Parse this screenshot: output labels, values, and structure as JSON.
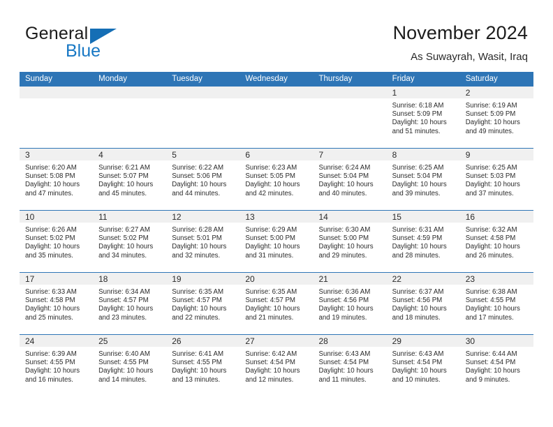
{
  "brand": {
    "word_one": "General",
    "word_two": "Blue",
    "accent_color": "#1878c4",
    "triangle_color": "#156eb5"
  },
  "header": {
    "title": "November 2024",
    "location": "As Suwayrah, Wasit, Iraq"
  },
  "theme": {
    "header_blue": "#2e75b6",
    "daynum_gray": "#f0f0f0",
    "text": "#2b2b2b"
  },
  "weekdays": [
    "Sunday",
    "Monday",
    "Tuesday",
    "Wednesday",
    "Thursday",
    "Friday",
    "Saturday"
  ],
  "labels": {
    "sunrise_prefix": "Sunrise:",
    "sunset_prefix": "Sunset:",
    "daylight_prefix": "Daylight:"
  },
  "weeks": [
    [
      {
        "day": "",
        "empty": true
      },
      {
        "day": "",
        "empty": true
      },
      {
        "day": "",
        "empty": true
      },
      {
        "day": "",
        "empty": true
      },
      {
        "day": "",
        "empty": true
      },
      {
        "day": "1",
        "sunrise": "Sunrise: 6:18 AM",
        "sunset": "Sunset: 5:09 PM",
        "daylight": "Daylight: 10 hours and 51 minutes."
      },
      {
        "day": "2",
        "sunrise": "Sunrise: 6:19 AM",
        "sunset": "Sunset: 5:09 PM",
        "daylight": "Daylight: 10 hours and 49 minutes."
      }
    ],
    [
      {
        "day": "3",
        "sunrise": "Sunrise: 6:20 AM",
        "sunset": "Sunset: 5:08 PM",
        "daylight": "Daylight: 10 hours and 47 minutes."
      },
      {
        "day": "4",
        "sunrise": "Sunrise: 6:21 AM",
        "sunset": "Sunset: 5:07 PM",
        "daylight": "Daylight: 10 hours and 45 minutes."
      },
      {
        "day": "5",
        "sunrise": "Sunrise: 6:22 AM",
        "sunset": "Sunset: 5:06 PM",
        "daylight": "Daylight: 10 hours and 44 minutes."
      },
      {
        "day": "6",
        "sunrise": "Sunrise: 6:23 AM",
        "sunset": "Sunset: 5:05 PM",
        "daylight": "Daylight: 10 hours and 42 minutes."
      },
      {
        "day": "7",
        "sunrise": "Sunrise: 6:24 AM",
        "sunset": "Sunset: 5:04 PM",
        "daylight": "Daylight: 10 hours and 40 minutes."
      },
      {
        "day": "8",
        "sunrise": "Sunrise: 6:25 AM",
        "sunset": "Sunset: 5:04 PM",
        "daylight": "Daylight: 10 hours and 39 minutes."
      },
      {
        "day": "9",
        "sunrise": "Sunrise: 6:25 AM",
        "sunset": "Sunset: 5:03 PM",
        "daylight": "Daylight: 10 hours and 37 minutes."
      }
    ],
    [
      {
        "day": "10",
        "sunrise": "Sunrise: 6:26 AM",
        "sunset": "Sunset: 5:02 PM",
        "daylight": "Daylight: 10 hours and 35 minutes."
      },
      {
        "day": "11",
        "sunrise": "Sunrise: 6:27 AM",
        "sunset": "Sunset: 5:02 PM",
        "daylight": "Daylight: 10 hours and 34 minutes."
      },
      {
        "day": "12",
        "sunrise": "Sunrise: 6:28 AM",
        "sunset": "Sunset: 5:01 PM",
        "daylight": "Daylight: 10 hours and 32 minutes."
      },
      {
        "day": "13",
        "sunrise": "Sunrise: 6:29 AM",
        "sunset": "Sunset: 5:00 PM",
        "daylight": "Daylight: 10 hours and 31 minutes."
      },
      {
        "day": "14",
        "sunrise": "Sunrise: 6:30 AM",
        "sunset": "Sunset: 5:00 PM",
        "daylight": "Daylight: 10 hours and 29 minutes."
      },
      {
        "day": "15",
        "sunrise": "Sunrise: 6:31 AM",
        "sunset": "Sunset: 4:59 PM",
        "daylight": "Daylight: 10 hours and 28 minutes."
      },
      {
        "day": "16",
        "sunrise": "Sunrise: 6:32 AM",
        "sunset": "Sunset: 4:58 PM",
        "daylight": "Daylight: 10 hours and 26 minutes."
      }
    ],
    [
      {
        "day": "17",
        "sunrise": "Sunrise: 6:33 AM",
        "sunset": "Sunset: 4:58 PM",
        "daylight": "Daylight: 10 hours and 25 minutes."
      },
      {
        "day": "18",
        "sunrise": "Sunrise: 6:34 AM",
        "sunset": "Sunset: 4:57 PM",
        "daylight": "Daylight: 10 hours and 23 minutes."
      },
      {
        "day": "19",
        "sunrise": "Sunrise: 6:35 AM",
        "sunset": "Sunset: 4:57 PM",
        "daylight": "Daylight: 10 hours and 22 minutes."
      },
      {
        "day": "20",
        "sunrise": "Sunrise: 6:35 AM",
        "sunset": "Sunset: 4:57 PM",
        "daylight": "Daylight: 10 hours and 21 minutes."
      },
      {
        "day": "21",
        "sunrise": "Sunrise: 6:36 AM",
        "sunset": "Sunset: 4:56 PM",
        "daylight": "Daylight: 10 hours and 19 minutes."
      },
      {
        "day": "22",
        "sunrise": "Sunrise: 6:37 AM",
        "sunset": "Sunset: 4:56 PM",
        "daylight": "Daylight: 10 hours and 18 minutes."
      },
      {
        "day": "23",
        "sunrise": "Sunrise: 6:38 AM",
        "sunset": "Sunset: 4:55 PM",
        "daylight": "Daylight: 10 hours and 17 minutes."
      }
    ],
    [
      {
        "day": "24",
        "sunrise": "Sunrise: 6:39 AM",
        "sunset": "Sunset: 4:55 PM",
        "daylight": "Daylight: 10 hours and 16 minutes."
      },
      {
        "day": "25",
        "sunrise": "Sunrise: 6:40 AM",
        "sunset": "Sunset: 4:55 PM",
        "daylight": "Daylight: 10 hours and 14 minutes."
      },
      {
        "day": "26",
        "sunrise": "Sunrise: 6:41 AM",
        "sunset": "Sunset: 4:55 PM",
        "daylight": "Daylight: 10 hours and 13 minutes."
      },
      {
        "day": "27",
        "sunrise": "Sunrise: 6:42 AM",
        "sunset": "Sunset: 4:54 PM",
        "daylight": "Daylight: 10 hours and 12 minutes."
      },
      {
        "day": "28",
        "sunrise": "Sunrise: 6:43 AM",
        "sunset": "Sunset: 4:54 PM",
        "daylight": "Daylight: 10 hours and 11 minutes."
      },
      {
        "day": "29",
        "sunrise": "Sunrise: 6:43 AM",
        "sunset": "Sunset: 4:54 PM",
        "daylight": "Daylight: 10 hours and 10 minutes."
      },
      {
        "day": "30",
        "sunrise": "Sunrise: 6:44 AM",
        "sunset": "Sunset: 4:54 PM",
        "daylight": "Daylight: 10 hours and 9 minutes."
      }
    ]
  ]
}
